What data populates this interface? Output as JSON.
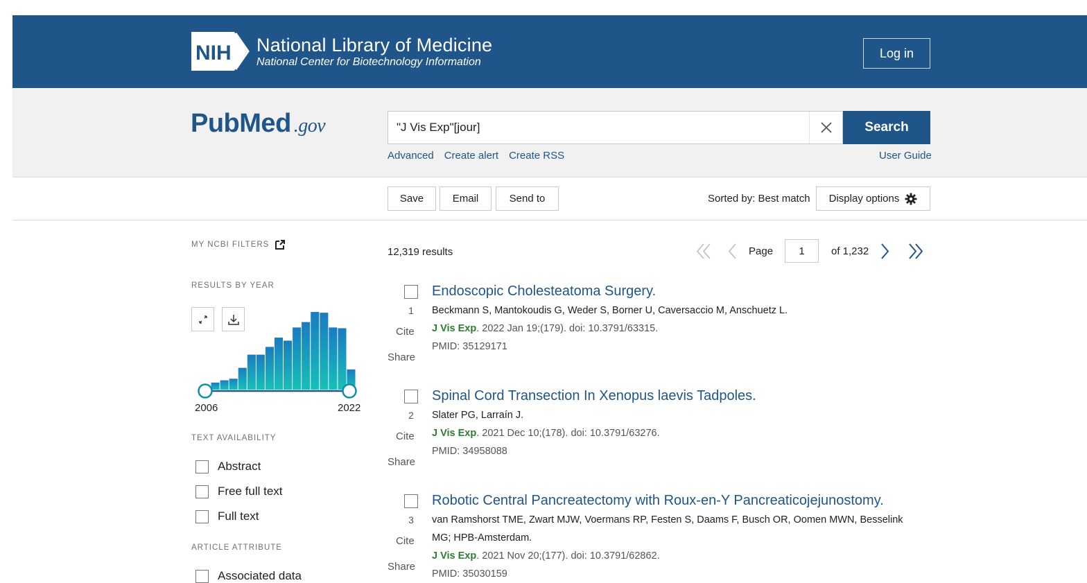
{
  "header": {
    "nih_badge": "NIH",
    "title": "National Library of Medicine",
    "subtitle": "National Center for Biotechnology Information",
    "login_label": "Log in",
    "bg_color": "#20558a"
  },
  "search": {
    "logo_pub": "Pub",
    "logo_med": "Med",
    "logo_gov": ".gov",
    "query": "\"J Vis Exp\"[jour]",
    "button_label": "Search",
    "links": [
      "Advanced",
      "Create alert",
      "Create RSS"
    ],
    "user_guide": "User Guide"
  },
  "actions": {
    "save": "Save",
    "email": "Email",
    "send_to": "Send to",
    "sorted_by": "Sorted by: Best match",
    "display_options": "Display options"
  },
  "sidebar": {
    "my_filters": "MY NCBI FILTERS",
    "results_by_year": "RESULTS BY YEAR",
    "year_start": "2006",
    "year_end": "2022",
    "year_bar_heights_relative": [
      0.09,
      0.12,
      0.14,
      0.28,
      0.45,
      0.45,
      0.55,
      0.67,
      0.63,
      0.8,
      0.87,
      1.0,
      0.99,
      0.8,
      0.79,
      0.26
    ],
    "text_availability": "TEXT AVAILABILITY",
    "text_filters": [
      "Abstract",
      "Free full text",
      "Full text"
    ],
    "article_attribute": "ARTICLE ATTRIBUTE",
    "attribute_filters": [
      "Associated data"
    ]
  },
  "results": {
    "count": "12,319 results",
    "page_label": "Page",
    "page_value": "1",
    "of_pages": "of 1,232",
    "cite_label": "Cite",
    "share_label": "Share",
    "items": [
      {
        "num": "1",
        "title": "Endoscopic Cholesteatoma Surgery.",
        "authors": "Beckmann S, Mantokoudis G, Weder S, Borner U, Caversaccio M, Anschuetz L.",
        "journal": "J Vis Exp",
        "citation": ". 2022 Jan 19;(179). doi: 10.3791/63315.",
        "pmid": "PMID: 35129171"
      },
      {
        "num": "2",
        "title": "Spinal Cord Transection In Xenopus laevis Tadpoles.",
        "authors": "Slater PG, Larraín J.",
        "journal": "J Vis Exp",
        "citation": ". 2021 Dec 10;(178). doi: 10.3791/63276.",
        "pmid": "PMID: 34958088"
      },
      {
        "num": "3",
        "title": "Robotic Central Pancreatectomy with Roux-en-Y Pancreaticojejunostomy.",
        "authors": "van Ramshorst TME, Zwart MJW, Voermans RP, Festen S, Daams F, Busch OR, Oomen MWN, Besselink MG; HPB-Amsterdam.",
        "journal": "J Vis Exp",
        "citation": ". 2021 Nov 20;(177). doi: 10.3791/62862.",
        "pmid": "PMID: 35030159"
      }
    ]
  }
}
